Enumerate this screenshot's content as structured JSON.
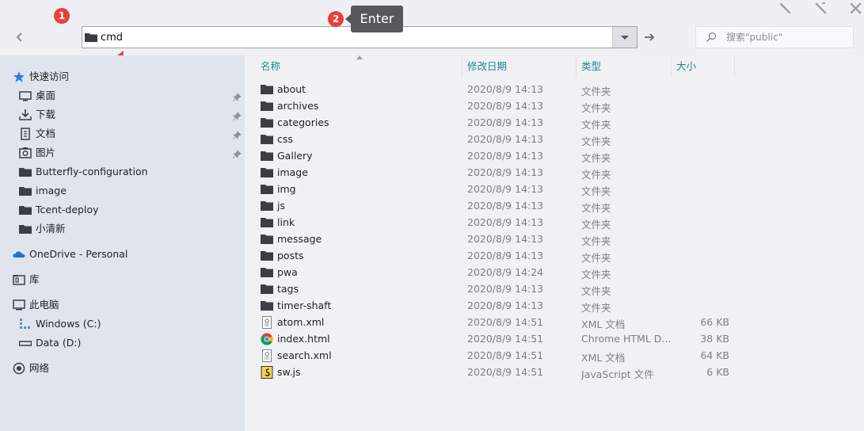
{
  "toolbar": {
    "address": "cmd",
    "search_placeholder": "搜索\"public\""
  },
  "annotations": {
    "badge1": "1",
    "badge2": "2",
    "tip": "Enter"
  },
  "sidebar": {
    "quick_access": "快速访问",
    "items": [
      {
        "label": "桌面",
        "icon": "desktop-icon",
        "pinned": true
      },
      {
        "label": "下载",
        "icon": "download-icon",
        "pinned": true
      },
      {
        "label": "文档",
        "icon": "document-icon",
        "pinned": true
      },
      {
        "label": "图片",
        "icon": "picture-icon",
        "pinned": true
      },
      {
        "label": "Butterfly-configuration",
        "icon": "folder-icon",
        "pinned": false
      },
      {
        "label": "image",
        "icon": "folder-icon",
        "pinned": false
      },
      {
        "label": "Tcent-deploy",
        "icon": "folder-icon",
        "pinned": false
      },
      {
        "label": "小清新",
        "icon": "folder-icon",
        "pinned": false
      }
    ],
    "onedrive": "OneDrive - Personal",
    "libraries": "库",
    "this_pc": "此电脑",
    "drives": [
      "Windows (C:)",
      "Data (D:)"
    ],
    "network": "网络"
  },
  "columns": {
    "name": "名称",
    "date": "修改日期",
    "type": "类型",
    "size": "大小"
  },
  "files": [
    {
      "name": "about",
      "date": "2020/8/9 14:13",
      "type": "文件夹",
      "size": "",
      "icon": "folder-icon"
    },
    {
      "name": "archives",
      "date": "2020/8/9 14:13",
      "type": "文件夹",
      "size": "",
      "icon": "folder-icon"
    },
    {
      "name": "categories",
      "date": "2020/8/9 14:13",
      "type": "文件夹",
      "size": "",
      "icon": "folder-icon"
    },
    {
      "name": "css",
      "date": "2020/8/9 14:13",
      "type": "文件夹",
      "size": "",
      "icon": "folder-icon"
    },
    {
      "name": "Gallery",
      "date": "2020/8/9 14:13",
      "type": "文件夹",
      "size": "",
      "icon": "folder-icon"
    },
    {
      "name": "image",
      "date": "2020/8/9 14:13",
      "type": "文件夹",
      "size": "",
      "icon": "folder-icon"
    },
    {
      "name": "img",
      "date": "2020/8/9 14:13",
      "type": "文件夹",
      "size": "",
      "icon": "folder-icon"
    },
    {
      "name": "js",
      "date": "2020/8/9 14:13",
      "type": "文件夹",
      "size": "",
      "icon": "folder-icon"
    },
    {
      "name": "link",
      "date": "2020/8/9 14:13",
      "type": "文件夹",
      "size": "",
      "icon": "folder-icon"
    },
    {
      "name": "message",
      "date": "2020/8/9 14:13",
      "type": "文件夹",
      "size": "",
      "icon": "folder-icon"
    },
    {
      "name": "posts",
      "date": "2020/8/9 14:13",
      "type": "文件夹",
      "size": "",
      "icon": "folder-icon"
    },
    {
      "name": "pwa",
      "date": "2020/8/9 14:24",
      "type": "文件夹",
      "size": "",
      "icon": "folder-icon"
    },
    {
      "name": "tags",
      "date": "2020/8/9 14:13",
      "type": "文件夹",
      "size": "",
      "icon": "folder-icon"
    },
    {
      "name": "timer-shaft",
      "date": "2020/8/9 14:13",
      "type": "文件夹",
      "size": "",
      "icon": "folder-icon"
    },
    {
      "name": "atom.xml",
      "date": "2020/8/9 14:51",
      "type": "XML 文档",
      "size": "66 KB",
      "icon": "xml-file-icon"
    },
    {
      "name": "index.html",
      "date": "2020/8/9 14:51",
      "type": "Chrome HTML D...",
      "size": "38 KB",
      "icon": "chrome-html-icon"
    },
    {
      "name": "search.xml",
      "date": "2020/8/9 14:51",
      "type": "XML 文档",
      "size": "64 KB",
      "icon": "xml-file-icon"
    },
    {
      "name": "sw.js",
      "date": "2020/8/9 14:51",
      "type": "JavaScript 文件",
      "size": "6 KB",
      "icon": "js-file-icon"
    }
  ],
  "colors": {
    "accent_header": "#1b8a8e",
    "sidebar_bg": "#dfe4ed",
    "folder": "#3a3f46",
    "annotation_red": "#e8403a",
    "onedrive_blue": "#1e73c9"
  }
}
